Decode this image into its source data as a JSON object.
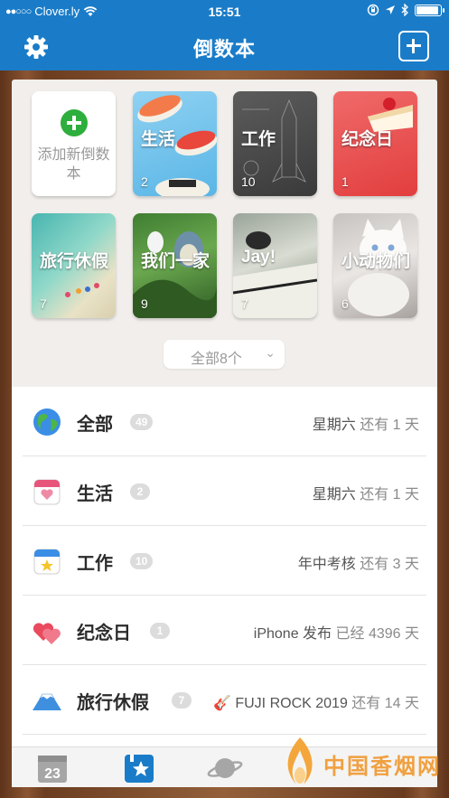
{
  "status_bar": {
    "carrier": "Clover.ly",
    "time": "15:51",
    "battery_level": 0.95
  },
  "nav": {
    "title": "倒数本"
  },
  "grid": {
    "add_tile_label": "添加新倒数本",
    "tiles": [
      {
        "label": "生活",
        "count": "2"
      },
      {
        "label": "工作",
        "count": "10"
      },
      {
        "label": "纪念日",
        "count": "1"
      },
      {
        "label": "旅行休假",
        "count": "7"
      },
      {
        "label": "我们一家",
        "count": "9"
      },
      {
        "label": "Jay!",
        "count": "7"
      },
      {
        "label": "小动物们",
        "count": "6"
      }
    ],
    "dropdown_label": "全部8个"
  },
  "list": {
    "rows": [
      {
        "title": "全部",
        "badge": "49",
        "event": "星期六",
        "status": "还有 1 天",
        "icon": "globe-icon"
      },
      {
        "title": "生活",
        "badge": "2",
        "event": "星期六",
        "status": "还有 1 天",
        "icon": "heart-calendar-icon"
      },
      {
        "title": "工作",
        "badge": "10",
        "event": "年中考核",
        "status": "还有 3 天",
        "icon": "star-calendar-icon"
      },
      {
        "title": "纪念日",
        "badge": "1",
        "event": "iPhone 发布",
        "status": "已经 4396 天",
        "icon": "hearts-icon"
      },
      {
        "title": "旅行休假",
        "badge": "7",
        "event": "🎸 FUJI ROCK 2019",
        "status": "还有 14 天",
        "icon": "mount-fuji-icon"
      }
    ]
  },
  "tabbar": {
    "calendar_day": "23"
  },
  "watermark": {
    "text": "中国香烟网"
  },
  "colors": {
    "primary_blue": "#1a7cc8",
    "add_green": "#2eae3c"
  }
}
